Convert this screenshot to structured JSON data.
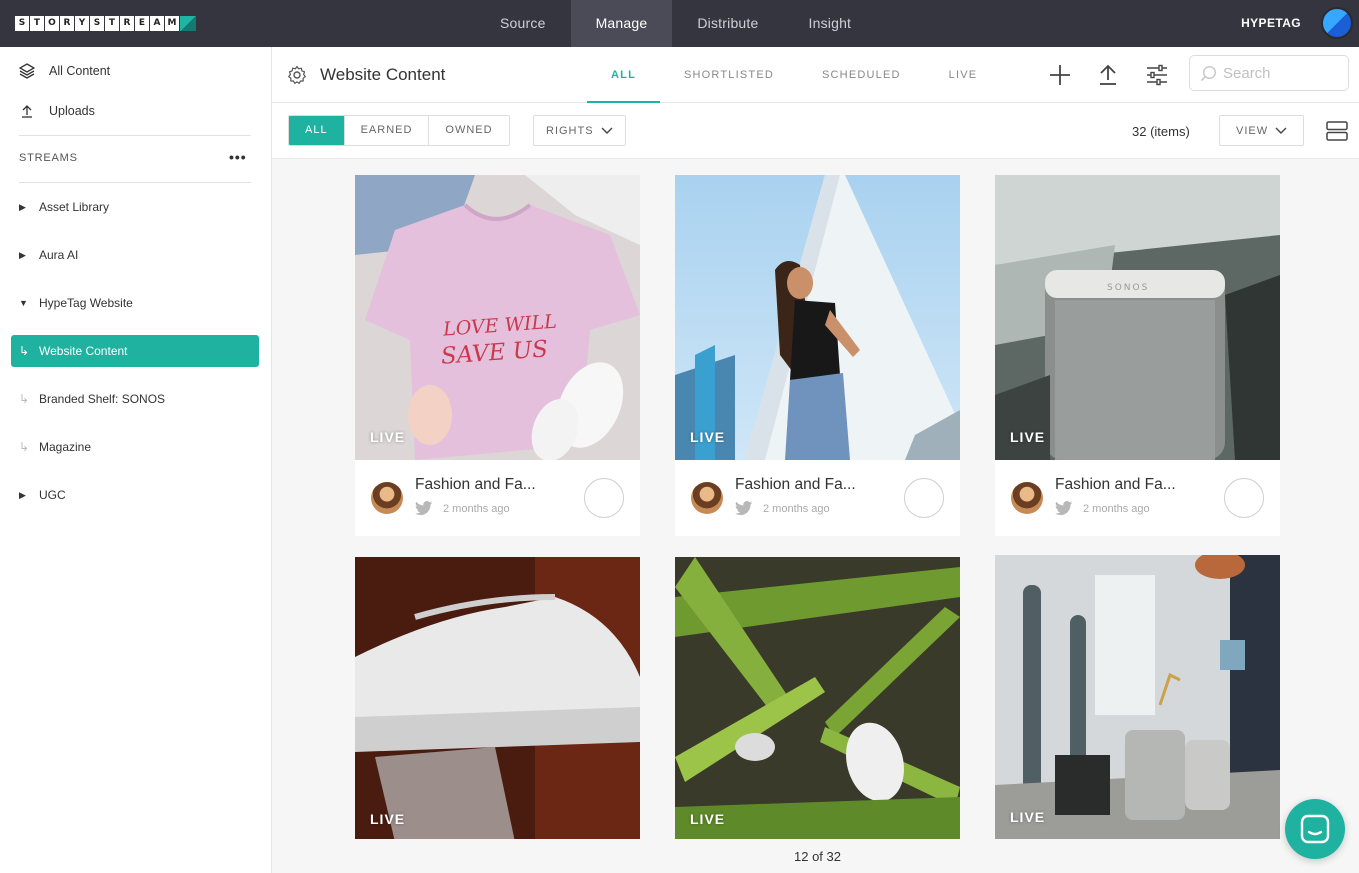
{
  "topbar": {
    "logo_letters": [
      "S",
      "T",
      "O",
      "R",
      "Y",
      "S",
      "T",
      "R",
      "E",
      "A",
      "M"
    ],
    "nav": [
      {
        "label": "Source",
        "active": false
      },
      {
        "label": "Manage",
        "active": true
      },
      {
        "label": "Distribute",
        "active": false
      },
      {
        "label": "Insight",
        "active": false
      }
    ],
    "brand_name": "HYPETAG"
  },
  "sidebar": {
    "all_content": "All Content",
    "uploads": "Uploads",
    "streams_label": "STREAMS",
    "streams_more": "•••",
    "streams": [
      {
        "label": "Asset Library",
        "kind": "collapsed"
      },
      {
        "label": "Aura AI",
        "kind": "collapsed"
      },
      {
        "label": "HypeTag Website",
        "kind": "expanded"
      },
      {
        "label": "Website Content",
        "kind": "child",
        "selected": true
      },
      {
        "label": "Branded Shelf: SONOS",
        "kind": "child"
      },
      {
        "label": "Magazine",
        "kind": "child"
      },
      {
        "label": "UGC",
        "kind": "collapsed"
      }
    ]
  },
  "header": {
    "title": "Website Content",
    "tabs": [
      {
        "label": "ALL",
        "active": true
      },
      {
        "label": "SHORTLISTED",
        "active": false
      },
      {
        "label": "SCHEDULED",
        "active": false
      },
      {
        "label": "LIVE",
        "active": false
      }
    ],
    "search_placeholder": "Search"
  },
  "filters": {
    "segments": [
      {
        "label": "ALL",
        "active": true
      },
      {
        "label": "EARNED",
        "active": false
      },
      {
        "label": "OWNED",
        "active": false
      }
    ],
    "rights_label": "RIGHTS",
    "count": "32 (items)",
    "view_label": "VIEW"
  },
  "cards": [
    {
      "badge": "LIVE",
      "title": "Fashion and Fa...",
      "time": "2 months ago",
      "image": "pink-tshirt"
    },
    {
      "badge": "LIVE",
      "title": "Fashion and Fa...",
      "time": "2 months ago",
      "image": "woman-building"
    },
    {
      "badge": "LIVE",
      "title": "Fashion and Fa...",
      "time": "2 months ago",
      "image": "sonos-speaker"
    },
    {
      "badge": "LIVE",
      "image": "white-sneaker"
    },
    {
      "badge": "LIVE",
      "image": "fern-sneaker"
    },
    {
      "badge": "LIVE",
      "image": "living-room-speakers"
    }
  ],
  "pager": "12 of 32",
  "colors": {
    "accent": "#1fb2a0",
    "topbar": "#353540",
    "topbar_active": "#4b4b57"
  }
}
